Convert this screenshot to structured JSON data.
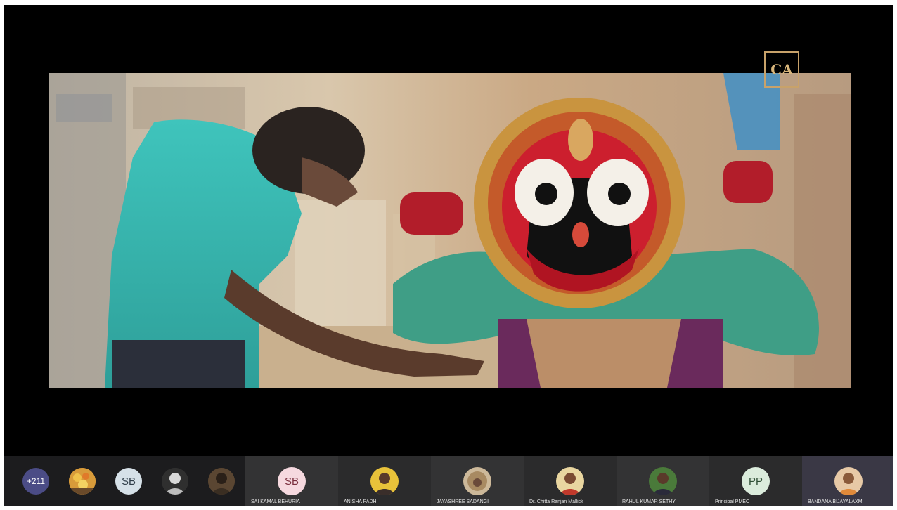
{
  "meeting": {
    "shared_video": {
      "watermark_text": "CA"
    }
  },
  "participant_strip": {
    "overflow_count": "+211",
    "mini_avatars": [
      {
        "kind": "photo",
        "icon": "flower-photo-avatar"
      },
      {
        "kind": "initials",
        "initials": "SB"
      },
      {
        "kind": "photo",
        "icon": "person-photo-avatar"
      },
      {
        "kind": "photo",
        "icon": "person-photo-avatar"
      }
    ],
    "tiles": [
      {
        "name": "SAI KAMAL BEHURIA",
        "initials": "SB",
        "avatar": "initials"
      },
      {
        "name": "ANISHA PADHI",
        "avatar": "photo"
      },
      {
        "name": "JAYASHREE SADANGI",
        "avatar": "photo"
      },
      {
        "name": "Dr. Chitta Ranjan Mallick",
        "avatar": "photo"
      },
      {
        "name": "RAHUL KUMAR SETHY",
        "avatar": "photo"
      },
      {
        "name": "Principal PMEC",
        "initials": "PP",
        "avatar": "initials"
      },
      {
        "name": "BANDANA BIJAYALAXMI",
        "avatar": "photo"
      }
    ]
  },
  "colors": {
    "stage_background": "#000000",
    "strip_background": "#1c1c1e",
    "overflow_badge": "#4b4c86"
  }
}
